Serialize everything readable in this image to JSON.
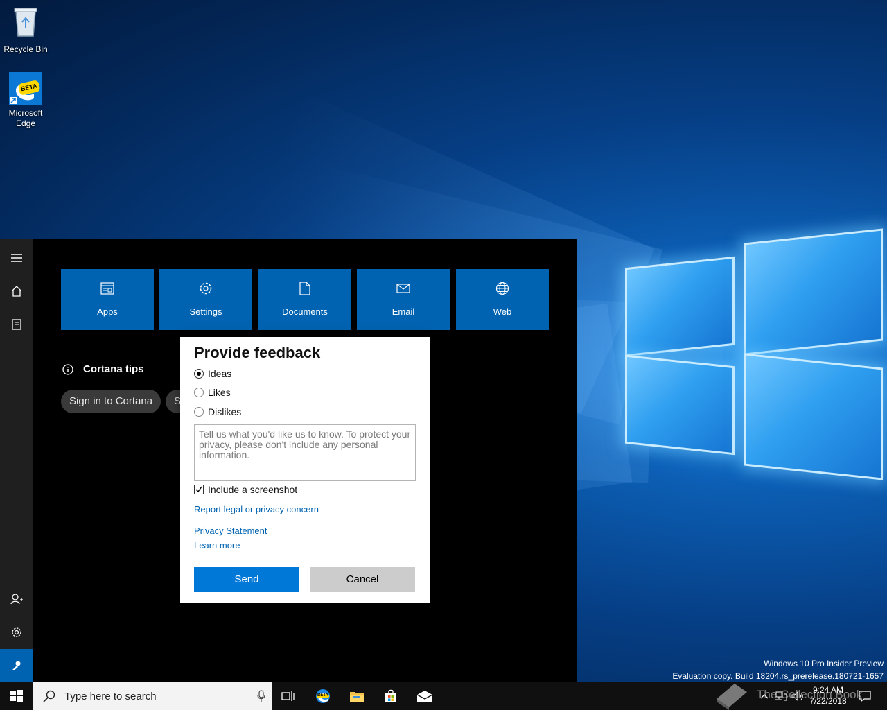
{
  "desktop": {
    "icons": [
      {
        "label": "Recycle Bin"
      },
      {
        "label_line1": "Microsoft",
        "label_line2": "Edge",
        "badge": "BETA"
      }
    ]
  },
  "panel": {
    "rail": [
      "hamburger-icon",
      "home-icon",
      "notebook-icon",
      "account-icon",
      "gear-icon",
      "feedback-icon"
    ],
    "tiles": [
      {
        "label": "Apps",
        "icon": "apps-icon"
      },
      {
        "label": "Settings",
        "icon": "gear-icon"
      },
      {
        "label": "Documents",
        "icon": "document-icon"
      },
      {
        "label": "Email",
        "icon": "mail-icon"
      },
      {
        "label": "Web",
        "icon": "globe-icon"
      }
    ],
    "tips_title": "Cortana tips",
    "chips": [
      "Sign in to Cortana",
      "S"
    ]
  },
  "feedback": {
    "title": "Provide feedback",
    "options": [
      "Ideas",
      "Likes",
      "Dislikes"
    ],
    "selected": "Ideas",
    "placeholder": "Tell us what you'd like us to know. To protect your privacy, please don't include any personal information.",
    "include_screenshot": "Include a screenshot",
    "include_screenshot_checked": true,
    "link_report": "Report legal or privacy concern",
    "link_privacy": "Privacy Statement",
    "link_learn": "Learn more",
    "send": "Send",
    "cancel": "Cancel"
  },
  "watermark": {
    "line1": "Windows 10 Pro Insider Preview",
    "line2": "Evaluation copy. Build 18204.rs_prerelease.180721-1657"
  },
  "taskbar": {
    "search_placeholder": "Type here to search",
    "time": "9:24 AM",
    "date": "7/22/2018",
    "edge_badge": "BETA"
  },
  "overlay": {
    "text": "The Collection Book"
  }
}
